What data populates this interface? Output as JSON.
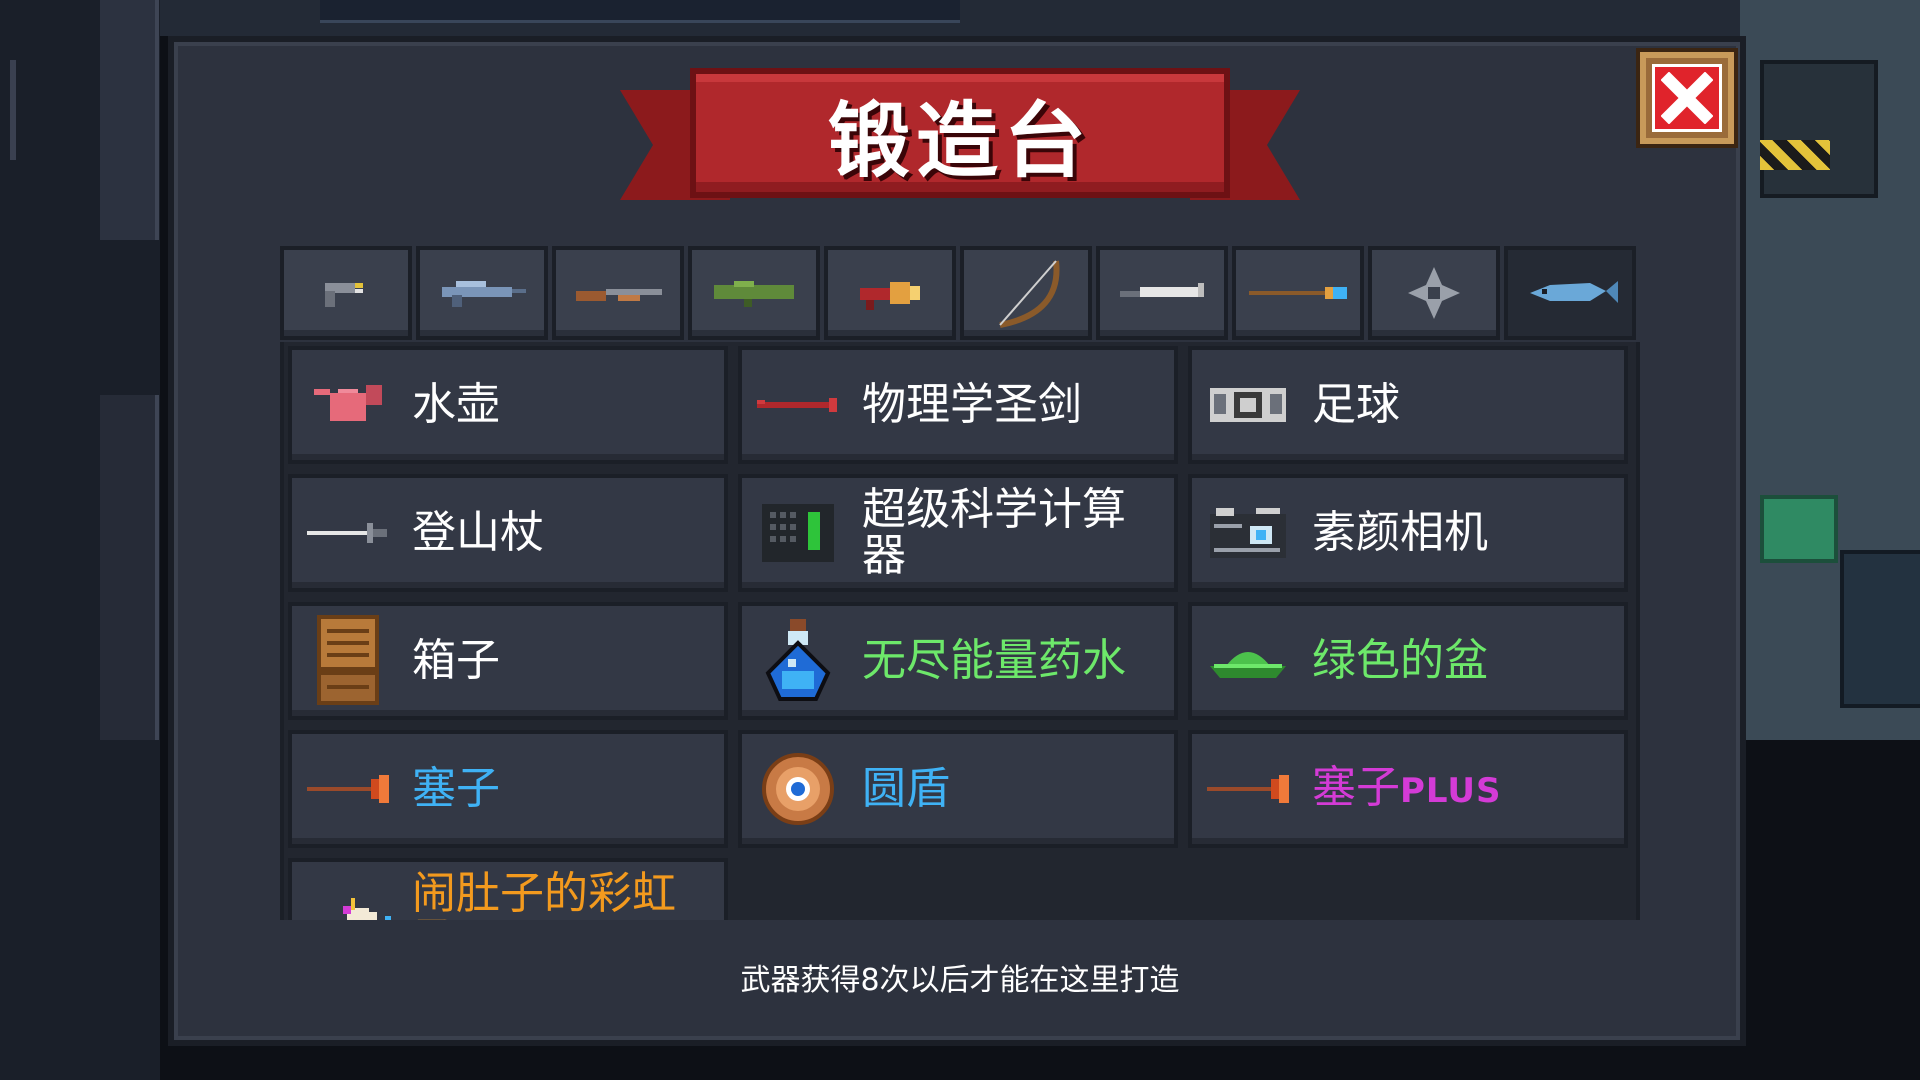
{
  "title": "锻造台",
  "close": {
    "icon": "close-x-icon"
  },
  "tabs": [
    {
      "icon": "pistol-icon",
      "active": false
    },
    {
      "icon": "rifle-icon",
      "active": false
    },
    {
      "icon": "shotgun-icon",
      "active": false
    },
    {
      "icon": "rocket-launcher-icon",
      "active": false
    },
    {
      "icon": "blaster-icon",
      "active": false
    },
    {
      "icon": "bow-icon",
      "active": false
    },
    {
      "icon": "blade-icon",
      "active": false
    },
    {
      "icon": "spear-icon",
      "active": false
    },
    {
      "icon": "shuriken-icon",
      "active": false
    },
    {
      "icon": "fish-icon",
      "active": true
    }
  ],
  "items": [
    {
      "label": "水壶",
      "color": "white",
      "icon": "watering-can-icon"
    },
    {
      "label": "物理学圣剑",
      "color": "white",
      "icon": "crowbar-icon"
    },
    {
      "label": "足球",
      "color": "white",
      "icon": "soccer-ball-icon"
    },
    {
      "label": "登山杖",
      "color": "white",
      "icon": "hiking-stick-icon"
    },
    {
      "label": "超级科学计算器",
      "color": "white",
      "icon": "calculator-icon"
    },
    {
      "label": "素颜相机",
      "color": "white",
      "icon": "camera-icon"
    },
    {
      "label": "箱子",
      "color": "white",
      "icon": "crate-icon"
    },
    {
      "label": "无尽能量药水",
      "color": "green",
      "icon": "potion-icon"
    },
    {
      "label": "绿色的盆",
      "color": "green",
      "icon": "green-basin-icon"
    },
    {
      "label": "塞子",
      "color": "blue",
      "icon": "plunger-icon"
    },
    {
      "label": "圆盾",
      "color": "blue",
      "icon": "round-shield-icon"
    },
    {
      "label": "塞子",
      "label_suffix": "PLUS",
      "color": "purple",
      "icon": "plunger-plus-icon"
    },
    {
      "label": "闹肚子的彩虹马",
      "color": "orange",
      "icon": "unicorn-icon"
    }
  ],
  "footer": "武器获得8次以后才能在这里打造"
}
